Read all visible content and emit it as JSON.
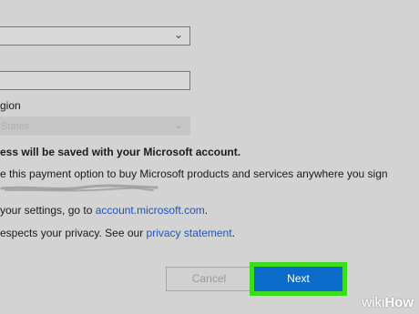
{
  "form": {
    "region_label": "gion",
    "region_value": "States",
    "saved_heading": "ess will be saved with your Microsoft account.",
    "payment_text": "e this payment option to buy Microsoft products and services anywhere you sign",
    "settings_prefix": "your settings, go to ",
    "settings_link": "account.microsoft.com",
    "settings_suffix": ".",
    "privacy_prefix": "espects your privacy. See our ",
    "privacy_link": "privacy statement",
    "privacy_suffix": "."
  },
  "buttons": {
    "cancel": "Cancel",
    "next": "Next"
  },
  "watermark": {
    "wiki": "wiki",
    "how": "How"
  },
  "colors": {
    "background": "#d3d3d3",
    "accent": "#0a6bc9",
    "highlight": "#3ddc1f",
    "link": "#1f56b5"
  },
  "icons": [
    "chevron-down-icon"
  ]
}
